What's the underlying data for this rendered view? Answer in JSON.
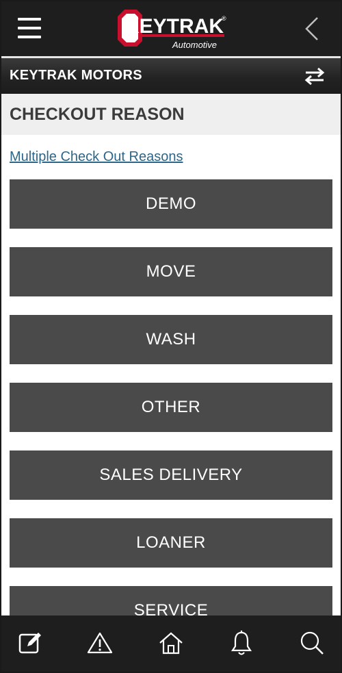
{
  "header": {
    "logo_text": "KEYTRAK",
    "logo_registered": "®",
    "logo_subtext": "Automotive",
    "icons": {
      "menu": "hamburger-menu-icon",
      "back": "chevron-left-icon"
    }
  },
  "location": {
    "name": "KEYTRAK MOTORS",
    "switch_icon": "swap-arrows-icon"
  },
  "section": {
    "title": "CHECKOUT REASON"
  },
  "multiple_link": "Multiple Check Out Reasons",
  "reasons": [
    "DEMO",
    "MOVE",
    "WASH",
    "OTHER",
    "SALES DELIVERY",
    "LOANER",
    "SERVICE"
  ],
  "bottom_nav": {
    "items": [
      "edit-icon",
      "warning-icon",
      "home-icon",
      "bell-icon",
      "search-icon"
    ]
  },
  "colors": {
    "header_bg": "#1e1e1e",
    "logo_red": "#c8102e",
    "button_bg": "#4a4a4a",
    "link": "#2d6689",
    "section_bg": "#efefef"
  }
}
